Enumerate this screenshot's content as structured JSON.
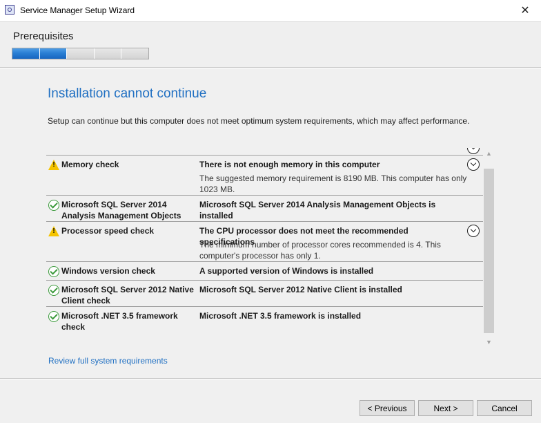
{
  "window": {
    "title": "Service Manager Setup Wizard",
    "close_glyph": "✕"
  },
  "header": {
    "step_title": "Prerequisites",
    "progress": {
      "segments_total": 5,
      "segments_completed": 2
    }
  },
  "main": {
    "title": "Installation cannot continue",
    "description": "Setup can continue but this computer does not meet optimum system requirements, which may affect performance.",
    "checks": [
      {
        "status": "warning",
        "name": "Memory check",
        "result": "There is not enough memory in this computer",
        "detail": "The suggested memory requirement is 8190 MB. This computer has only 1023 MB.",
        "expandable": true
      },
      {
        "status": "passed",
        "name": "Microsoft SQL Server 2014 Analysis Management Objects",
        "result": "Microsoft SQL Server 2014 Analysis Management Objects is installed",
        "detail": "",
        "expandable": false
      },
      {
        "status": "warning",
        "name": "Processor speed check",
        "result": "The CPU processor does not meet the recommended specifications",
        "detail": "The minimum number of processor cores recommended is 4. This computer's processor has only 1.",
        "expandable": true
      },
      {
        "status": "passed",
        "name": "Windows version check",
        "result": "A supported version of Windows is installed",
        "detail": "",
        "expandable": false
      },
      {
        "status": "passed",
        "name": "Microsoft SQL Server 2012 Native Client check",
        "result": "Microsoft SQL Server 2012 Native Client is installed",
        "detail": "",
        "expandable": false
      },
      {
        "status": "passed",
        "name": "Microsoft .NET 3.5 framework check",
        "result": "Microsoft .NET 3.5 framework is installed",
        "detail": "",
        "expandable": false
      }
    ],
    "review_link": "Review full system requirements"
  },
  "footer": {
    "previous_label": "< Previous",
    "next_label": "Next >",
    "cancel_label": "Cancel"
  },
  "colors": {
    "accent": "#1f6fc2",
    "progress_fill": "#2a7fd4",
    "warning": "#f5c400",
    "success": "#3c9a3c"
  },
  "icons": {
    "warning": "warning-icon",
    "passed": "check-circle-icon",
    "expand": "chevron-down-icon"
  }
}
